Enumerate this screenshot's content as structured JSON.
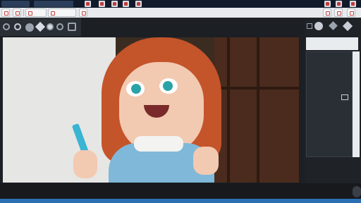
{
  "titlebar": {
    "tabs": [
      "",
      ""
    ],
    "accent": "#2b3e5c"
  },
  "toolbar": {
    "buttons": [
      "undo-icon",
      "brush-icon",
      "layers-icon",
      "grid-icon",
      "view-icon"
    ],
    "right_buttons": [
      "pin-icon",
      "shield-icon",
      "eraser-icon"
    ]
  },
  "left_tools": [
    "lasso-icon",
    "circle-icon",
    "moon-icon",
    "drop-icon",
    "shape-icon",
    "ring-icon",
    "square-icon"
  ],
  "right_panel": {
    "top_icons": [
      "circle-dot-icon",
      "diamond-icon",
      "gem-icon"
    ],
    "rows": [
      "",
      "",
      "",
      "",
      "",
      "",
      "",
      "",
      ""
    ],
    "brand_color": "#2d6fb3"
  },
  "colors": {
    "canvas_bg": "#3b2c22",
    "hair": "#c4542a",
    "skin": "#f2c9b1",
    "shirt": "#7fb8d8"
  }
}
